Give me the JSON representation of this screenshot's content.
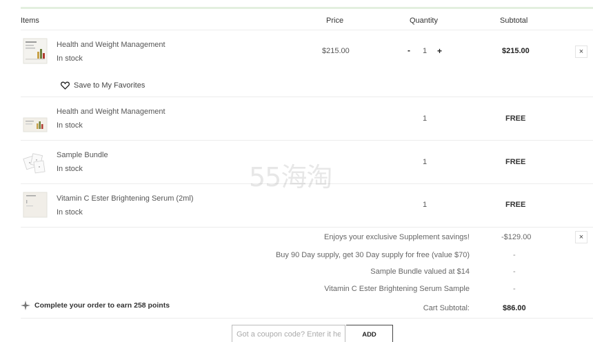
{
  "columns": {
    "items": "Items",
    "price": "Price",
    "quantity": "Quantity",
    "subtotal": "Subtotal"
  },
  "items": [
    {
      "name": "Health and Weight Management",
      "stock": "In stock",
      "price": "$215.00",
      "quantity": "1",
      "decrement": "-",
      "increment": "+",
      "subtotal": "$215.00",
      "remove": "×"
    },
    {
      "name": "Health and Weight Management",
      "stock": "In stock",
      "quantity": "1",
      "subtotal": "FREE"
    },
    {
      "name": "Sample Bundle",
      "stock": "In stock",
      "quantity": "1",
      "subtotal": "FREE"
    },
    {
      "name": "Vitamin C Ester Brightening Serum (2ml)",
      "stock": "In stock",
      "quantity": "1",
      "subtotal": "FREE"
    }
  ],
  "favorites_label": "Save to My Favorites",
  "promotions": [
    {
      "label": "Enjoys your exclusive Supplement savings!",
      "value": "-$129.00",
      "remove": "×"
    },
    {
      "label": "Buy 90 Day supply, get 30 Day supply for free (value $70)",
      "value": "-"
    },
    {
      "label": "Sample Bundle valued at $14",
      "value": "-"
    },
    {
      "label": "Vitamin C Ester Brightening Serum Sample",
      "value": "-"
    }
  ],
  "points_text": "Complete your order to earn 258 points",
  "cart_subtotal": {
    "label": "Cart Subtotal:",
    "value": "$86.00"
  },
  "coupon": {
    "placeholder": "Got a coupon code? Enter it here",
    "button": "ADD"
  },
  "watermark": "55海淘",
  "colors": {
    "accent_line": "#e3efdf",
    "divider": "#ececec"
  }
}
